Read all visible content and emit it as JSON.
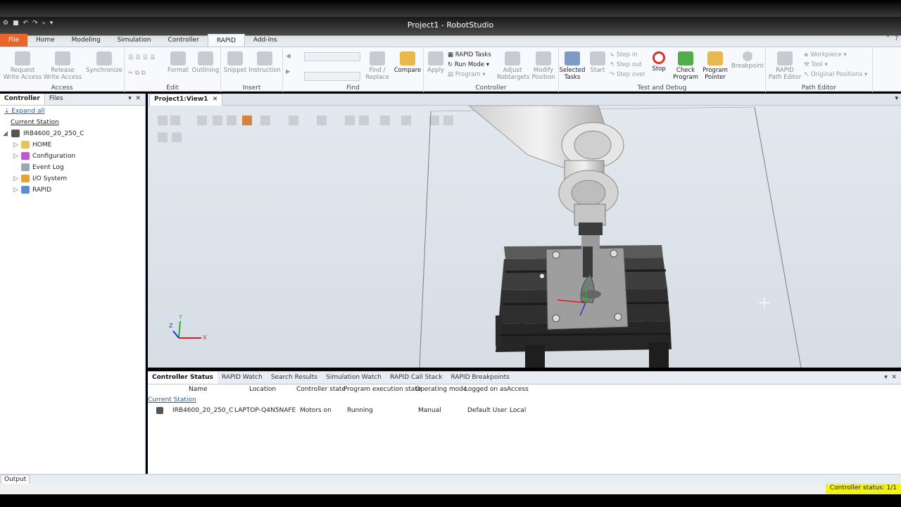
{
  "window": {
    "title": "Project1 - RobotStudio"
  },
  "ribbon_tabs": [
    "File",
    "Home",
    "Modeling",
    "Simulation",
    "Controller",
    "RAPID",
    "Add-Ins"
  ],
  "ribbon": {
    "access": {
      "label": "Access",
      "request": "Request\nWrite Access",
      "release": "Release\nWrite Access",
      "sync": "Synchronize"
    },
    "edit": {
      "label": "Edit",
      "format": "Format",
      "outlining": "Outlining"
    },
    "insert": {
      "label": "Insert",
      "snippet": "Snippet",
      "instruction": "Instruction"
    },
    "find": {
      "label": "Find",
      "find_replace": "Find /\nReplace",
      "compare": "Compare"
    },
    "controller": {
      "label": "Controller",
      "apply": "Apply",
      "rapid_tasks": "RAPID Tasks",
      "run_mode": "Run Mode",
      "program": "Program",
      "adjust": "Adjust\nRobtargets",
      "modify": "Modify\nPosition"
    },
    "test_debug": {
      "label": "Test and Debug",
      "selected_tasks": "Selected\nTasks",
      "start": "Start",
      "step_in": "Step in",
      "step_out": "Step out",
      "step_over": "Step over",
      "stop": "Stop",
      "check": "Check\nProgram",
      "pointer": "Program\nPointer",
      "breakpoint": "Breakpoint"
    },
    "path_editor": {
      "label": "Path Editor",
      "rapid_path_editor": "RAPID\nPath Editor",
      "workpiece": "Workpiece",
      "tool": "Tool",
      "original_positions": "Original Positions"
    }
  },
  "left_panel": {
    "tabs": [
      "Controller",
      "Files"
    ],
    "expand_all": "Expand all",
    "current_station": "Current Station",
    "controller_name": "IRB4600_20_250_C",
    "items": [
      "HOME",
      "Configuration",
      "Event Log",
      "I/O System",
      "RAPID"
    ]
  },
  "view": {
    "tab": "Project1:View1",
    "axes": {
      "x": "X",
      "y": "Y",
      "z": "Z"
    }
  },
  "bottom_panel": {
    "tabs": [
      "Controller Status",
      "RAPID Watch",
      "Search Results",
      "Simulation Watch",
      "RAPID Call Stack",
      "RAPID Breakpoints"
    ],
    "columns": [
      "Name",
      "Location",
      "Controller state",
      "Program execution state",
      "Operating mode",
      "Logged on as",
      "Access"
    ],
    "group": "Current Station",
    "rows": [
      [
        "IRB4600_20_250_C",
        "LAPTOP-Q4N5NAFE",
        "Motors on",
        "Running",
        "Manual",
        "Default User",
        "Local"
      ]
    ]
  },
  "output_tab": "Output",
  "status": {
    "controller_status": "Controller status: 1/1"
  },
  "colors": {
    "file_tab": "#e9662a",
    "status_bg": "#f4f40a",
    "accent": "#1a5fb4"
  }
}
